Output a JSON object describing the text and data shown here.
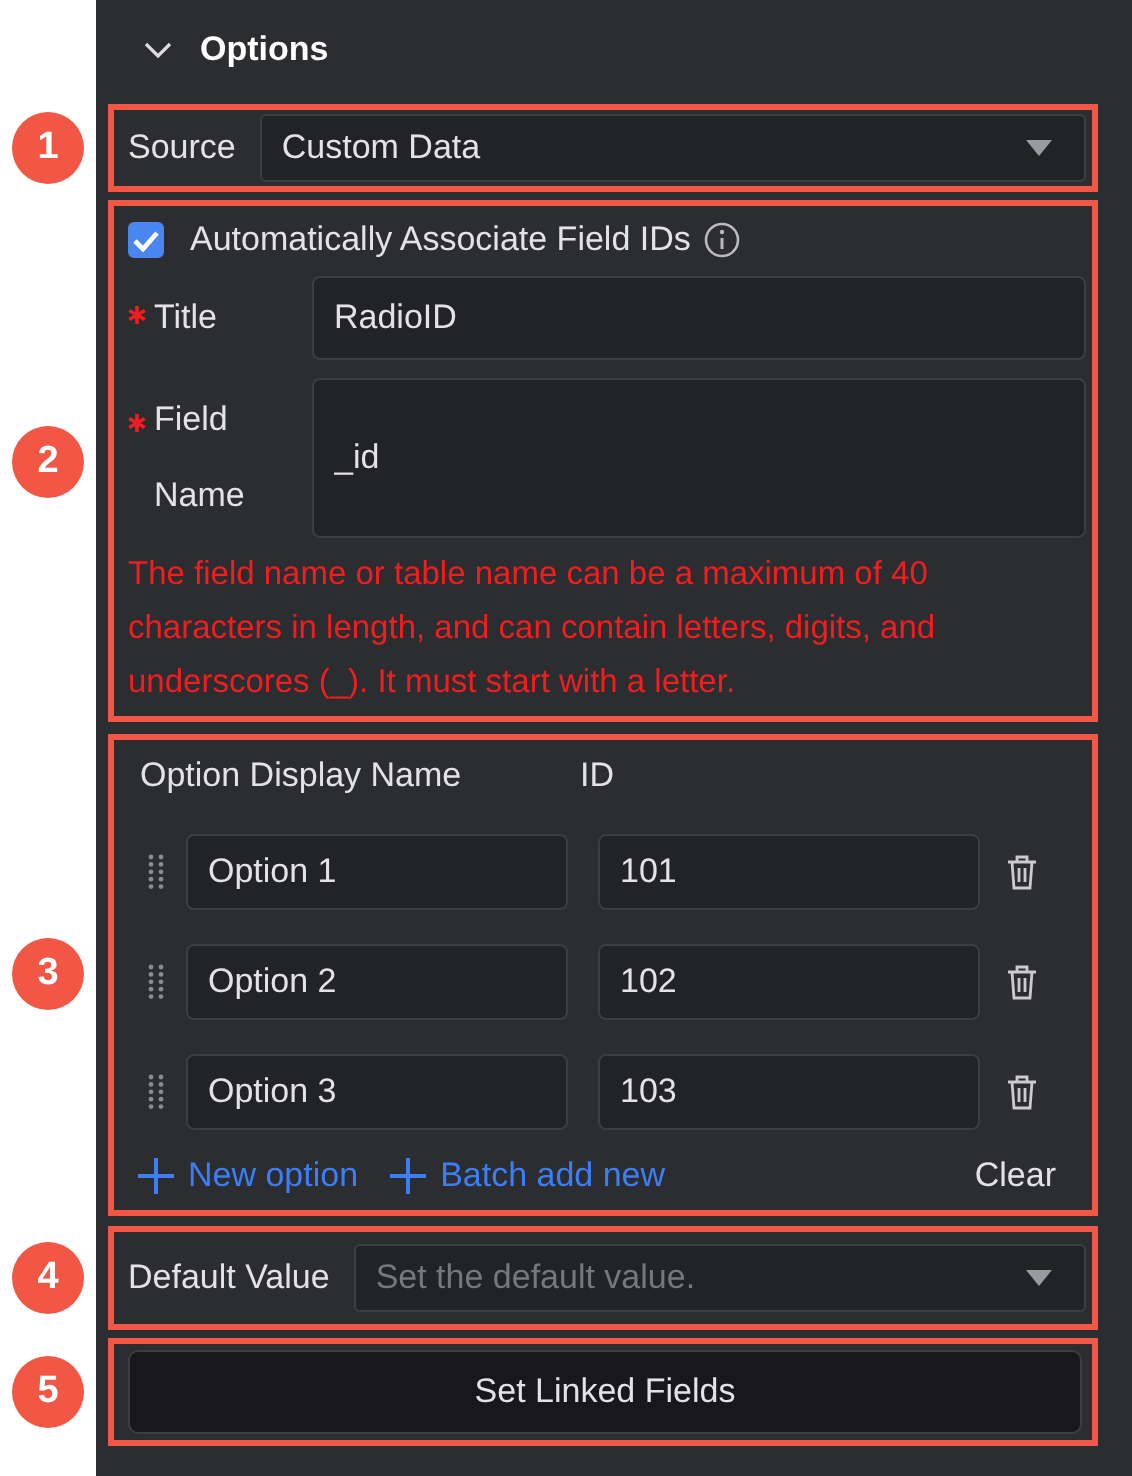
{
  "panel": {
    "title": "Options",
    "expanded": true
  },
  "source": {
    "callout": "1",
    "label": "Source",
    "value": "Custom Data"
  },
  "field_ids": {
    "callout": "2",
    "auto_associate": {
      "label": "Automatically Associate Field IDs",
      "checked": true
    },
    "title": {
      "label": "Title",
      "required": true,
      "value": "RadioID"
    },
    "field_name": {
      "label": "Field Name",
      "required": true,
      "value": "_id"
    },
    "error": "The field name or table name can be a maximum of 40 characters in length, and can contain letters, digits, and underscores (_). It must start with a letter."
  },
  "options": {
    "callout": "3",
    "columns": [
      "Option Display Name",
      "ID"
    ],
    "rows": [
      {
        "name": "Option 1",
        "id": "101"
      },
      {
        "name": "Option 2",
        "id": "102"
      },
      {
        "name": "Option 3",
        "id": "103"
      }
    ],
    "actions": [
      "New option",
      "Batch add new"
    ],
    "clear": "Clear"
  },
  "default_value": {
    "callout": "4",
    "label": "Default Value",
    "placeholder": "Set the default value."
  },
  "linked": {
    "callout": "5",
    "button": "Set Linked Fields"
  }
}
